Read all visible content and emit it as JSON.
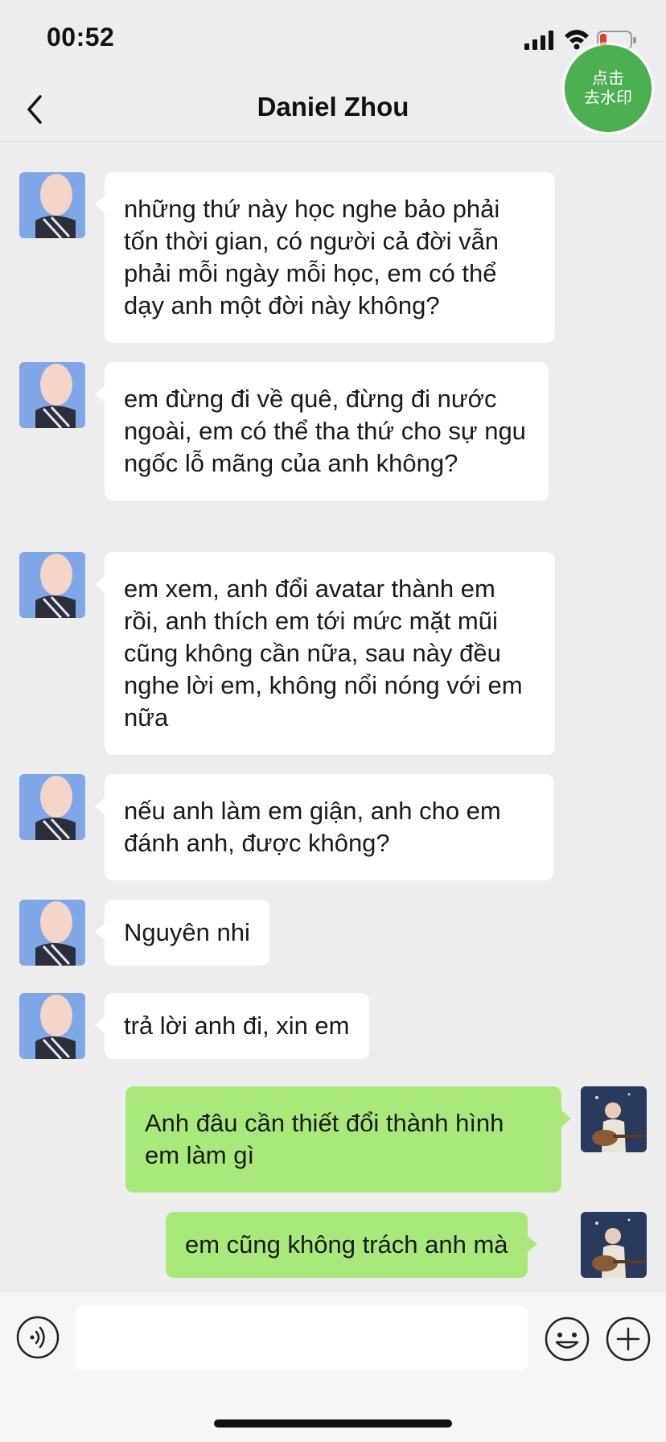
{
  "status_bar": {
    "time": "00:52"
  },
  "watermark_badge": {
    "line1": "点击",
    "line2": "去水印"
  },
  "nav": {
    "title": "Daniel Zhou"
  },
  "messages": [
    {
      "side": "in",
      "text": "những thứ này học nghe bảo phải tốn thời gian, có người cả đời vẫn phải mỗi ngày mỗi học, em có thể dạy anh một đời này không?"
    },
    {
      "side": "in",
      "text": "em đừng đi về quê, đừng đi nước ngoài, em có thể tha thứ cho sự ngu ngốc lỗ mãng của anh không?"
    },
    {
      "side": "in",
      "text": "em xem, anh đổi avatar thành em rồi, anh thích em tới mức mặt mũi cũng không cần nữa, sau này đều nghe lời em, không nổi nóng với em nữa"
    },
    {
      "side": "in",
      "text": "nếu anh làm em giận, anh cho em đánh anh, được không?"
    },
    {
      "side": "in",
      "text": "Nguyên nhi"
    },
    {
      "side": "in",
      "text": "trả lời anh đi, xin em"
    },
    {
      "side": "out",
      "text": "Anh đâu cần thiết đổi thành hình em làm gì"
    },
    {
      "side": "out",
      "text": "em cũng không trách anh mà"
    }
  ],
  "colors": {
    "incoming_bubble": "#ffffff",
    "outgoing_bubble": "#a9e87a",
    "background": "#ededed",
    "badge": "#4caf50"
  },
  "icons": [
    "signal-icon",
    "wifi-icon",
    "battery-icon",
    "back-icon",
    "voice-icon",
    "emoji-icon",
    "plus-icon"
  ]
}
